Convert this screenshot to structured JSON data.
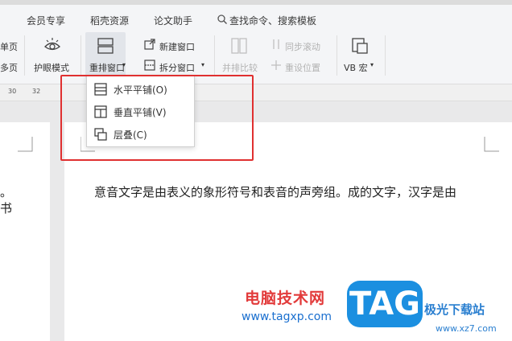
{
  "tabs": [
    "会员专享",
    "稻壳资源",
    "论文助手"
  ],
  "search": {
    "label": "查找命令、搜索模板",
    "icon": "search-icon"
  },
  "ribbon": {
    "page_single": "单页",
    "page_multi": "多页",
    "eye_mode": "护眼模式",
    "arrange": "重排窗口",
    "new_window": "新建窗口",
    "split_window": "拆分窗口",
    "compare": "并排比较",
    "sync_scroll": "同步滚动",
    "reset_pos": "重设位置",
    "vb_macro": "VB 宏"
  },
  "ruler": {
    "ticks": [
      "30",
      "32"
    ]
  },
  "dropdown": {
    "items": [
      {
        "label": "水平平铺(O)",
        "icon": "horizontal-tile-icon"
      },
      {
        "label": "垂直平铺(V)",
        "icon": "vertical-tile-icon"
      },
      {
        "label": "层叠(C)",
        "icon": "cascade-icon"
      }
    ]
  },
  "document": {
    "left_char1": "。",
    "left_char2": "书",
    "right_text": "意音文字是由表义的象形符号和表音的声旁组。成的文字，汉字是由"
  },
  "watermark": {
    "cn": "电脑技术网",
    "url": "www.tagxp.com",
    "badge": "TAG",
    "site": "极光下载站",
    "site_url": "www.xz7.com"
  },
  "colors": {
    "highlight": "#e03030",
    "accent": "#1b8fe0"
  }
}
